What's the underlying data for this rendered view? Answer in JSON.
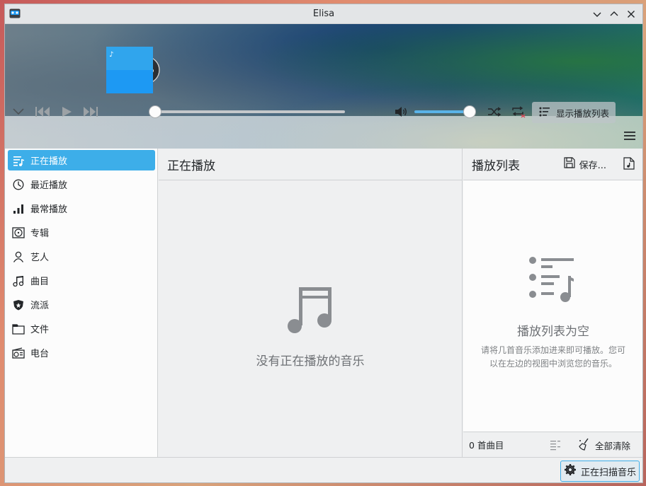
{
  "window": {
    "title": "Elisa",
    "icons": [
      "app-icon",
      "minimize-icon",
      "maximize-icon",
      "close-icon"
    ]
  },
  "header": {
    "album_art_icon": "music-disc-icon"
  },
  "transport": {
    "icons": [
      "chevron-down-icon",
      "skip-back-icon",
      "play-icon",
      "skip-forward-icon",
      "volume-icon",
      "shuffle-icon",
      "repeat-icon",
      "playlist-icon",
      "hamburger-menu-icon"
    ],
    "seek_progress": 0.0,
    "volume_level": 1.0,
    "toggle_playlist_label": "显示播放列表"
  },
  "sidebar": {
    "items": [
      {
        "label": "正在播放",
        "icon": "now-playing-icon",
        "active": true
      },
      {
        "label": "最近播放",
        "icon": "recent-icon",
        "active": false
      },
      {
        "label": "最常播放",
        "icon": "bar-chart-icon",
        "active": false
      },
      {
        "label": "专辑",
        "icon": "album-icon",
        "active": false
      },
      {
        "label": "艺人",
        "icon": "artist-icon",
        "active": false
      },
      {
        "label": "曲目",
        "icon": "music-note-icon",
        "active": false
      },
      {
        "label": "流派",
        "icon": "genre-icon",
        "active": false
      },
      {
        "label": "文件",
        "icon": "folder-icon",
        "active": false
      },
      {
        "label": "电台",
        "icon": "radio-icon",
        "active": false
      }
    ]
  },
  "center": {
    "title": "正在播放",
    "empty_message": "没有正在播放的音乐"
  },
  "playlist": {
    "title": "播放列表",
    "save_label": "保存...",
    "empty_title": "播放列表为空",
    "empty_description": "请将几首音乐添加进来即可播放。您可以在左边的视图中浏览您的音乐。",
    "track_count": "0 首曲目",
    "clear_label": "全部清除"
  },
  "status": {
    "scan_label": "正在扫描音乐"
  },
  "colors": {
    "accent": "#3daee9",
    "background": "#eff0f1",
    "panel": "#fcfcfc"
  }
}
